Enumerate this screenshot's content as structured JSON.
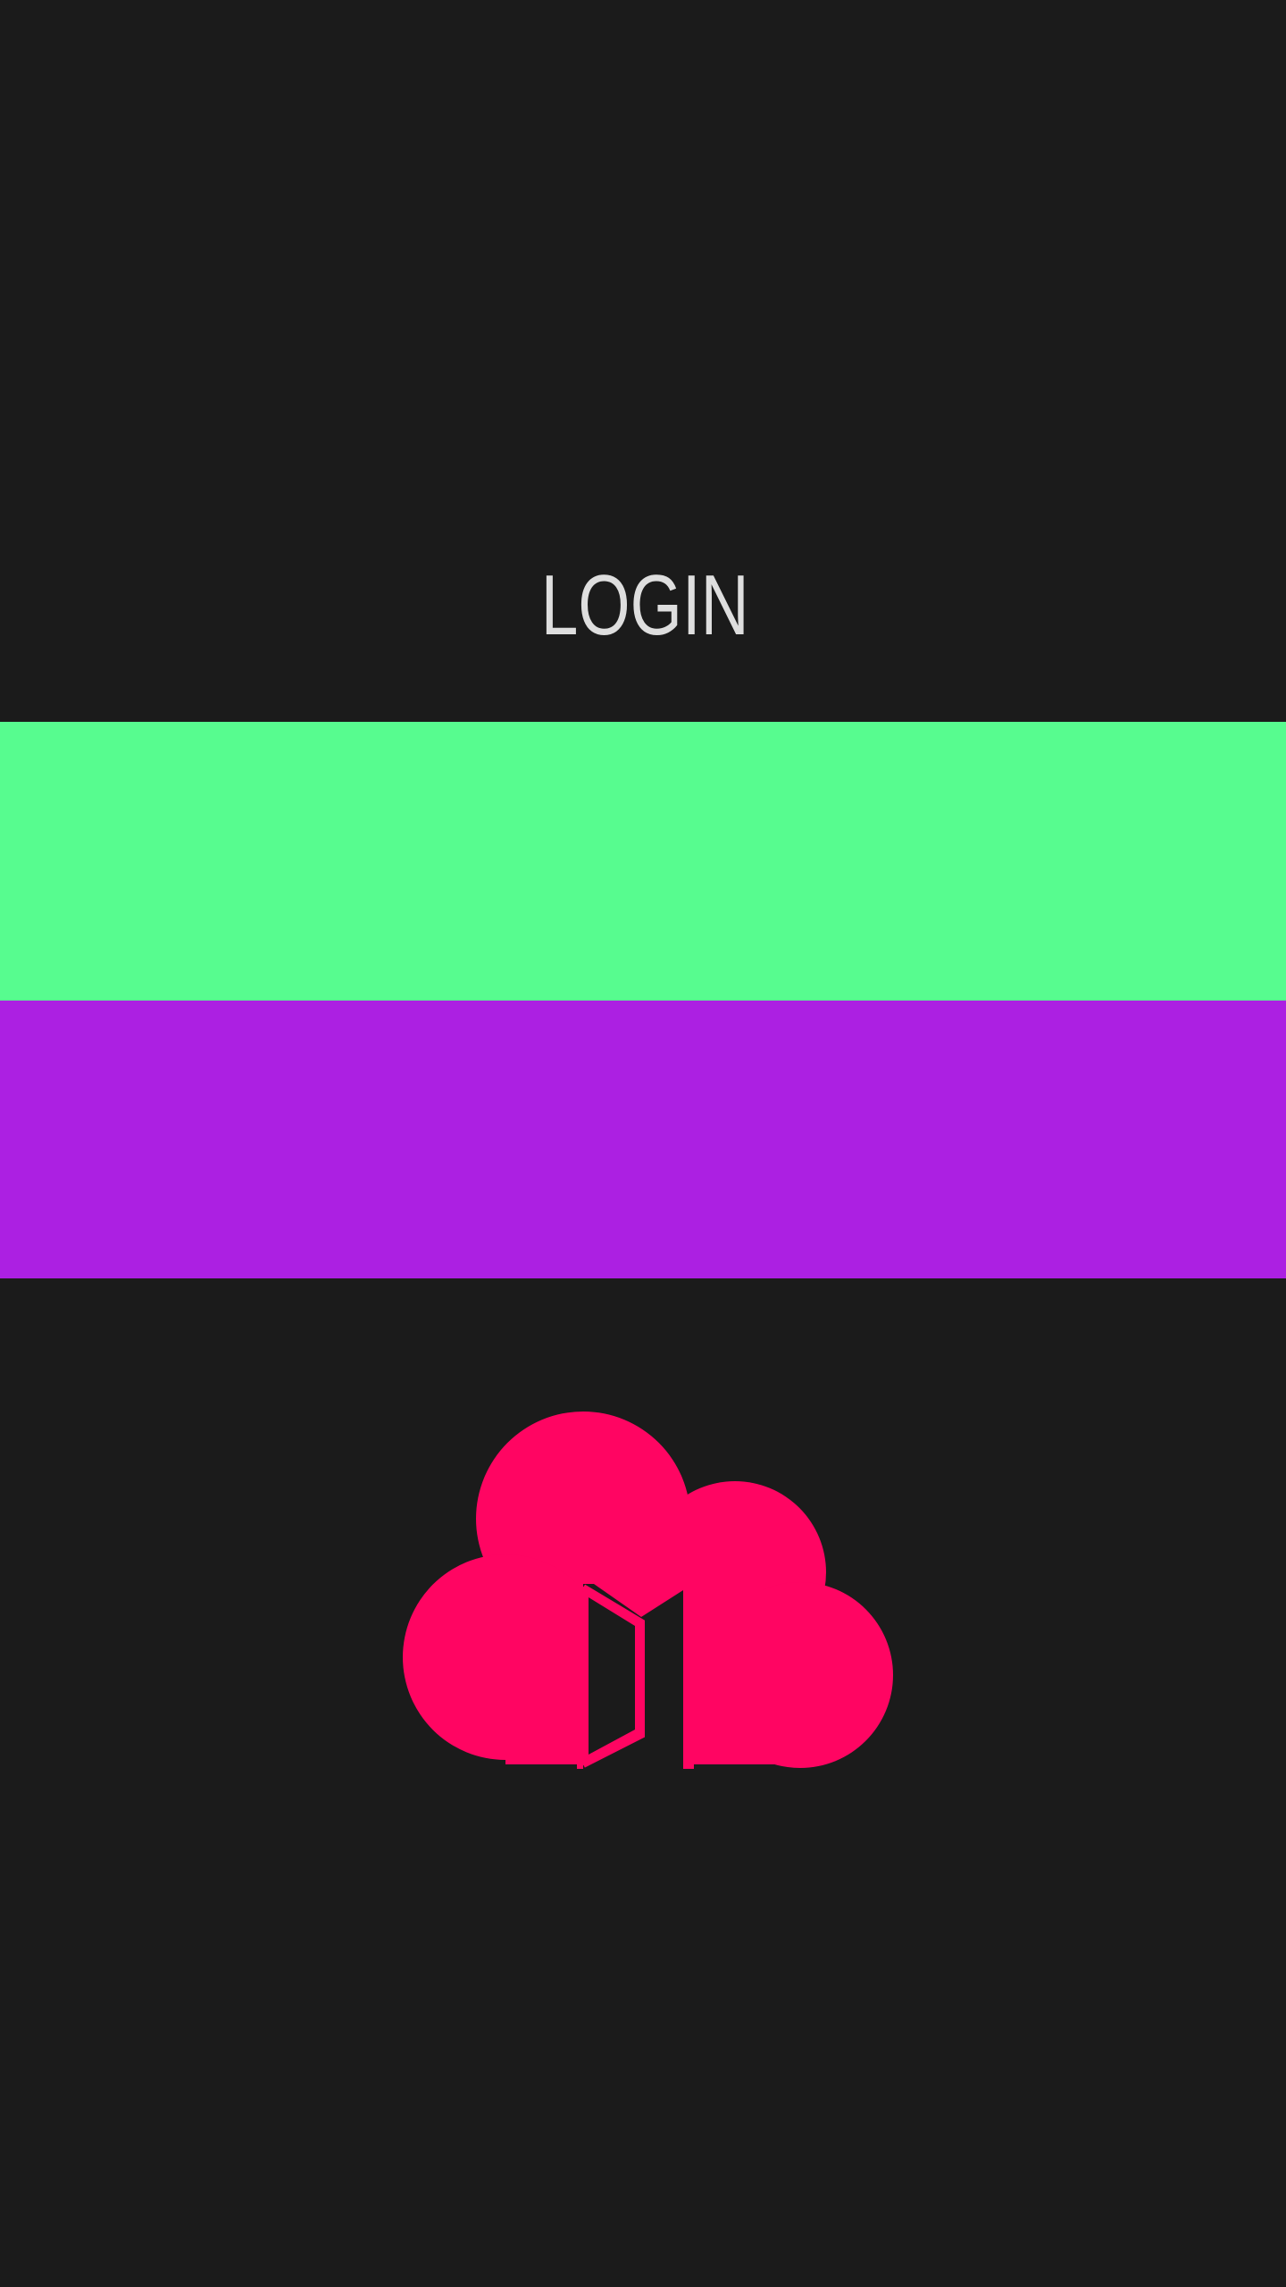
{
  "screen": {
    "title": "LOGIN"
  },
  "bands": [
    {
      "name": "green-band",
      "color": "#57fc8f"
    },
    {
      "name": "purple-band",
      "color": "#ac20e2"
    }
  ],
  "logo": {
    "icon": "cloud-door-icon",
    "color": "#ff0562"
  },
  "theme": {
    "background": "#1b1b1b",
    "title_color": "#dedede"
  }
}
